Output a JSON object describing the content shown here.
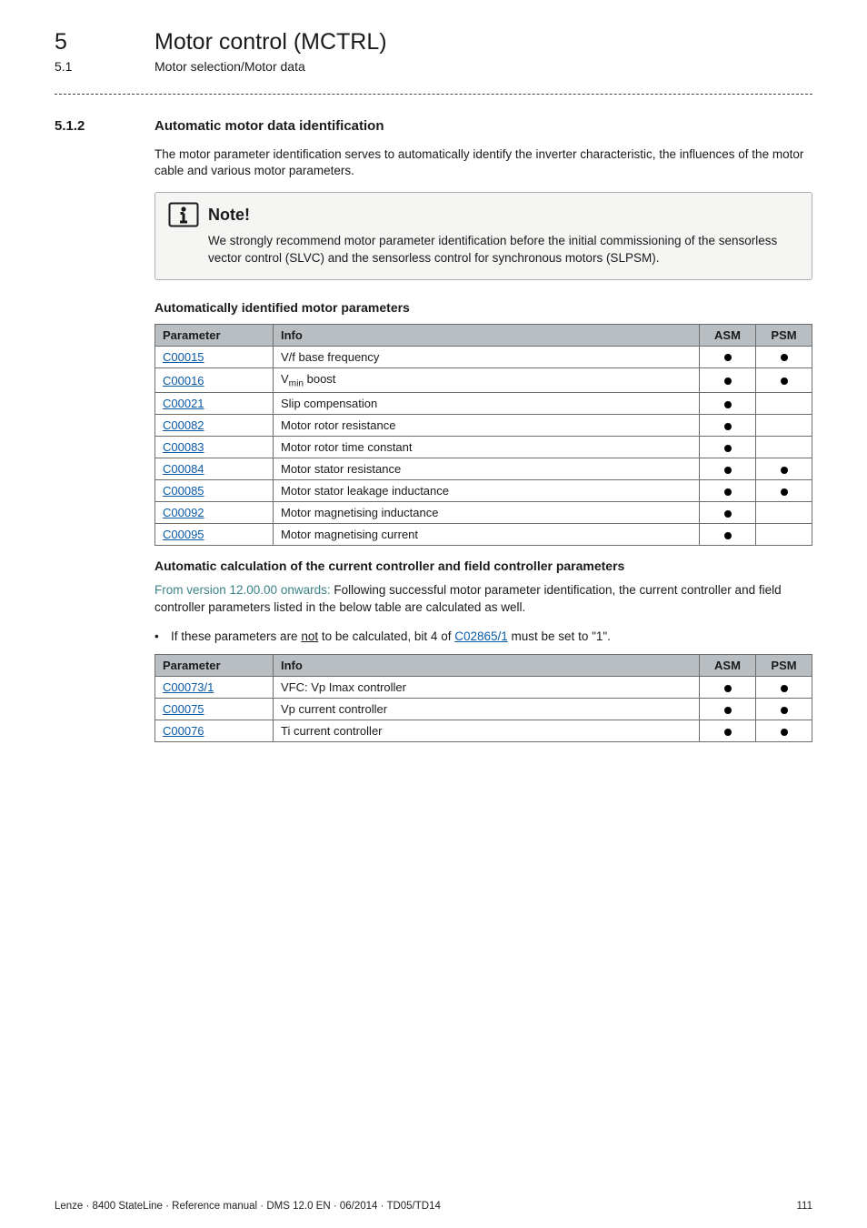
{
  "header": {
    "chapter_num": "5",
    "chapter_title": "Motor control (MCTRL)",
    "section_num": "5.1",
    "section_title": "Motor selection/Motor data"
  },
  "section": {
    "num": "5.1.2",
    "title": "Automatic  motor data identification",
    "intro": "The motor parameter identification serves to automatically identify the inverter characteristic, the influences of the motor cable and various motor parameters."
  },
  "note": {
    "title": "Note!",
    "body": "We strongly recommend motor parameter identification before the initial commissioning of the sensorless vector control (SLVC) and the sensorless control for synchronous motors (SLPSM)."
  },
  "auto_params": {
    "heading": "Automatically identified motor parameters",
    "cols": {
      "param": "Parameter",
      "info": "Info",
      "asm": "ASM",
      "psm": "PSM"
    },
    "rows": [
      {
        "param": "C00015",
        "info": "V/f base frequency",
        "asm": true,
        "psm": true
      },
      {
        "param": "C00016",
        "info_html": "V<sub>min</sub> boost",
        "asm": true,
        "psm": true
      },
      {
        "param": "C00021",
        "info": "Slip compensation",
        "asm": true,
        "psm": false
      },
      {
        "param": "C00082",
        "info": "Motor rotor resistance",
        "asm": true,
        "psm": false
      },
      {
        "param": "C00083",
        "info": "Motor rotor time constant",
        "asm": true,
        "psm": false
      },
      {
        "param": "C00084",
        "info": "Motor stator resistance",
        "asm": true,
        "psm": true
      },
      {
        "param": "C00085",
        "info": "Motor stator leakage inductance",
        "asm": true,
        "psm": true
      },
      {
        "param": "C00092",
        "info": "Motor magnetising inductance",
        "asm": true,
        "psm": false
      },
      {
        "param": "C00095",
        "info": "Motor magnetising current",
        "asm": true,
        "psm": false
      }
    ]
  },
  "auto_calc": {
    "heading": "Automatic calculation of the current controller and field controller parameters",
    "version_prefix": "From version 12.00.00 onwards:",
    "para_rest": " Following successful motor parameter identification, the current controller and field controller parameters listed in the below table are calculated as well.",
    "bullet_pre": "If these parameters are ",
    "bullet_not": "not",
    "bullet_mid": " to be calculated, bit 4 of ",
    "bullet_link": "C02865/1",
    "bullet_post": " must be set to \"1\".",
    "cols": {
      "param": "Parameter",
      "info": "Info",
      "asm": "ASM",
      "psm": "PSM"
    },
    "rows": [
      {
        "param": "C00073/1",
        "info": "VFC: Vp Imax controller",
        "asm": true,
        "psm": true
      },
      {
        "param": "C00075",
        "info": "Vp current controller",
        "asm": true,
        "psm": true
      },
      {
        "param": "C00076",
        "info": "Ti current controller",
        "asm": true,
        "psm": true
      }
    ]
  },
  "footer": {
    "left": "Lenze · 8400 StateLine · Reference manual · DMS 12.0 EN · 06/2014 · TD05/TD14",
    "right": "111"
  },
  "glyphs": {
    "bullet": "•"
  }
}
